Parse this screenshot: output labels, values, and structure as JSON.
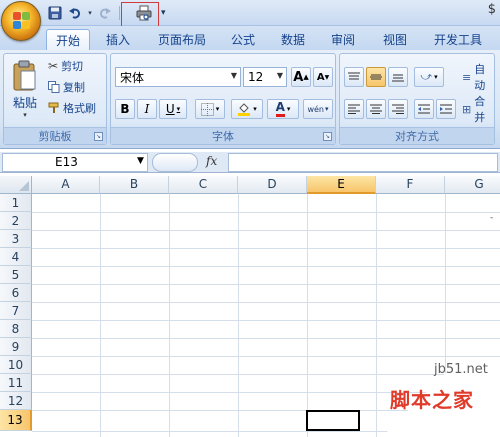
{
  "quick_access": {
    "items": [
      "save-icon",
      "undo-icon",
      "redo-icon",
      "print-preview-icon"
    ],
    "more_label": "▾",
    "right_glyph": "$"
  },
  "tabs": [
    {
      "label": "开始",
      "active": true
    },
    {
      "label": "插入"
    },
    {
      "label": "页面布局"
    },
    {
      "label": "公式"
    },
    {
      "label": "数据"
    },
    {
      "label": "审阅"
    },
    {
      "label": "视图"
    },
    {
      "label": "开发工具"
    }
  ],
  "clipboard": {
    "paste_label": "粘贴",
    "cut_label": "剪切",
    "copy_label": "复制",
    "format_painter_label": "格式刷",
    "group_label": "剪贴板"
  },
  "font": {
    "font_name": "宋体",
    "font_size": "12",
    "grow_label": "A",
    "shrink_label": "A",
    "bold_label": "B",
    "italic_label": "I",
    "underline_label": "U",
    "font_color_label": "A",
    "phonetic_label": "wén",
    "group_label": "字体"
  },
  "alignment": {
    "group_label": "对齐方式",
    "wrap_label": "自动",
    "merge_label": "合并"
  },
  "formula_bar": {
    "name_box": "E13",
    "fx_label": "fx",
    "formula": ""
  },
  "sheet": {
    "columns": [
      "A",
      "B",
      "C",
      "D",
      "E",
      "F",
      "G"
    ],
    "rows": [
      "1",
      "2",
      "3",
      "4",
      "5",
      "6",
      "7",
      "8",
      "9",
      "10",
      "11",
      "12",
      "13"
    ],
    "selected_column": "E",
    "selected_row": "13",
    "stray_mark": "-"
  },
  "watermark": {
    "url": "jb51.net",
    "name": "脚本之家"
  },
  "colors": {
    "accent": "#15428b",
    "selection": "#f7c56b",
    "highlight_box": "#d23a3a"
  }
}
